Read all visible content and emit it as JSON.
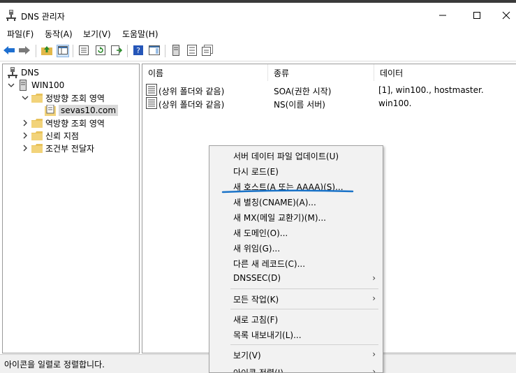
{
  "window": {
    "title": "DNS 관리자",
    "icons": {
      "app": "dns-manager-icon",
      "minimize": "minimize-icon",
      "maximize": "maximize-icon",
      "close": "close-icon"
    }
  },
  "menubar": {
    "file": "파일(F)",
    "action": "동작(A)",
    "view": "보기(V)",
    "help": "도움말(H)"
  },
  "toolbar": {
    "icons": [
      "back-arrow-icon",
      "forward-arrow-icon",
      "up-folder-icon",
      "show-hide-tree-icon",
      "properties-icon",
      "refresh-icon",
      "export-list-icon",
      "help-icon",
      "action-pane-icon",
      "server-icon",
      "zone-list-icon",
      "records-icon"
    ]
  },
  "tree": {
    "root": "DNS",
    "server": "WIN100",
    "forward_zones": "정방향 조회 영역",
    "zone": "sevas10.com",
    "reverse_zones": "역방향 조회 영역",
    "trust_points": "신뢰 지점",
    "conditional_forwarders": "조건부 전달자"
  },
  "records": {
    "columns": {
      "name": "이름",
      "type": "종류",
      "data": "데이터"
    },
    "rows": [
      {
        "name": "(상위 폴더와 같음)",
        "type": "SOA(권한 시작)",
        "data": "[1], win100., hostmaster."
      },
      {
        "name": "(상위 폴더와 같음)",
        "type": "NS(이름 서버)",
        "data": "win100."
      }
    ]
  },
  "context_menu": {
    "update_server_data": "서버 데이터 파일 업데이트(U)",
    "reload": "다시 로드(E)",
    "new_host": "새 호스트(A 또는 AAAA)(S)...",
    "new_alias": "새 별칭(CNAME)(A)...",
    "new_mx": "새 MX(메일 교환기)(M)...",
    "new_domain": "새 도메인(O)...",
    "new_delegation": "새 위임(G)...",
    "other_new_records": "다른 새 레코드(C)...",
    "dnssec": "DNSSEC(D)",
    "all_tasks": "모든 작업(K)",
    "refresh": "새로 고침(F)",
    "export_list": "목록 내보내기(L)...",
    "view": "보기(V)",
    "arrange_icons": "아이콘 정렬(I)",
    "submenu_arrow": "›",
    "highlight_color": "#1a73c8"
  },
  "status": {
    "text": "아이콘을 일렬로 정렬합니다."
  }
}
